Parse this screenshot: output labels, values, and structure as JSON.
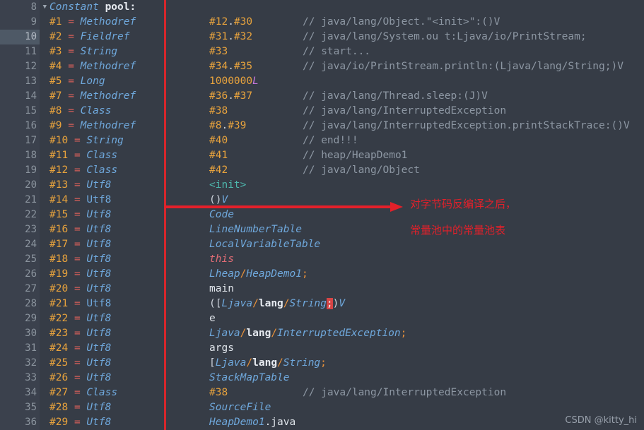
{
  "editor": {
    "theme_bg": "#363c46",
    "gutter_bg": "#3b414d",
    "accent_red": "#d6272c",
    "highlighted_line": 10
  },
  "gutter": {
    "lines": [
      "8",
      "9",
      "10",
      "11",
      "12",
      "13",
      "14",
      "15",
      "16",
      "17",
      "18",
      "19",
      "20",
      "21",
      "22",
      "23",
      "24",
      "25",
      "26",
      "27",
      "28",
      "29",
      "30",
      "31",
      "32",
      "33",
      "34",
      "35",
      "36"
    ],
    "fold_caret": "▼"
  },
  "code_lines": [
    {
      "num": "8",
      "a_index": "",
      "a_eq": "",
      "a_type": "Constant pool:",
      "a_style": "header",
      "b": "",
      "c": ""
    },
    {
      "num": "9",
      "a_index": "#1",
      "a_eq": "=",
      "a_type": "Methodref",
      "a_style": "kw",
      "b": "#12.#30",
      "b_style": "num",
      "c": "// java/lang/Object.\"<init>\":()V"
    },
    {
      "num": "10",
      "a_index": "#2",
      "a_eq": "=",
      "a_type": "Fieldref",
      "a_style": "kw",
      "b": "#31.#32",
      "b_style": "num",
      "c": "// java/lang/System.ou t:Ljava/io/PrintStream;"
    },
    {
      "num": "11",
      "a_index": "#3",
      "a_eq": "=",
      "a_type": "String",
      "a_style": "kw",
      "b": "#33",
      "b_style": "num",
      "c": "// start..."
    },
    {
      "num": "12",
      "a_index": "#4",
      "a_eq": "=",
      "a_type": "Methodref",
      "a_style": "kw",
      "b": "#34.#35",
      "b_style": "num",
      "c": "// java/io/PrintStream.println:(Ljava/lang/String;)V"
    },
    {
      "num": "13",
      "a_index": "#5",
      "a_eq": "=",
      "a_type": "Long",
      "a_style": "kw",
      "b": "1000000L",
      "b_style": "longlit",
      "c": ""
    },
    {
      "num": "14",
      "a_index": "#7",
      "a_eq": "=",
      "a_type": "Methodref",
      "a_style": "kw",
      "b": "#36.#37",
      "b_style": "num",
      "c": "// java/lang/Thread.sleep:(J)V"
    },
    {
      "num": "15",
      "a_index": "#8",
      "a_eq": "=",
      "a_type": "Class",
      "a_style": "kw",
      "b": "#38",
      "b_style": "num",
      "c": "// java/lang/InterruptedException"
    },
    {
      "num": "16",
      "a_index": "#9",
      "a_eq": "=",
      "a_type": "Methodref",
      "a_style": "kw",
      "b": "#8.#39",
      "b_style": "num",
      "c": "// java/lang/InterruptedException.printStackTrace:()V"
    },
    {
      "num": "17",
      "a_index": "#10",
      "a_eq": "=",
      "a_type": "String",
      "a_style": "kw",
      "b": "#40",
      "b_style": "num",
      "c": "// end!!!"
    },
    {
      "num": "18",
      "a_index": "#11",
      "a_eq": "=",
      "a_type": "Class",
      "a_style": "kw",
      "b": "#41",
      "b_style": "num",
      "c": "// heap/HeapDemo1"
    },
    {
      "num": "19",
      "a_index": "#12",
      "a_eq": "=",
      "a_type": "Class",
      "a_style": "kw",
      "b": "#42",
      "b_style": "num",
      "c": "// java/lang/Object"
    },
    {
      "num": "20",
      "a_index": "#13",
      "a_eq": "=",
      "a_type": "Utf8",
      "a_style": "kw",
      "b": "<init>",
      "b_style": "init",
      "c": ""
    },
    {
      "num": "21",
      "a_index": "#14",
      "a_eq": "=",
      "a_type": "Utf8",
      "a_style": "kwn",
      "b": "()V",
      "b_style": "parenV",
      "c": ""
    },
    {
      "num": "22",
      "a_index": "#15",
      "a_eq": "=",
      "a_type": "Utf8",
      "a_style": "kw",
      "b": "Code",
      "b_style": "sig",
      "c": ""
    },
    {
      "num": "23",
      "a_index": "#16",
      "a_eq": "=",
      "a_type": "Utf8",
      "a_style": "kw",
      "b": "LineNumberTable",
      "b_style": "sig",
      "c": ""
    },
    {
      "num": "24",
      "a_index": "#17",
      "a_eq": "=",
      "a_type": "Utf8",
      "a_style": "kw",
      "b": "LocalVariableTable",
      "b_style": "sig",
      "c": ""
    },
    {
      "num": "25",
      "a_index": "#18",
      "a_eq": "=",
      "a_type": "Utf8",
      "a_style": "kw",
      "b": "this",
      "b_style": "this",
      "c": ""
    },
    {
      "num": "26",
      "a_index": "#19",
      "a_eq": "=",
      "a_type": "Utf8",
      "a_style": "kw",
      "b": "Lheap/HeapDemo1;",
      "b_style": "desc1",
      "c": ""
    },
    {
      "num": "27",
      "a_index": "#20",
      "a_eq": "=",
      "a_type": "Utf8",
      "a_style": "kw",
      "b": "main",
      "b_style": "white",
      "c": ""
    },
    {
      "num": "28",
      "a_index": "#21",
      "a_eq": "=",
      "a_type": "Utf8",
      "a_style": "kwn",
      "b": "([Ljava/lang/String;)V",
      "b_style": "desc_main",
      "c": ""
    },
    {
      "num": "29",
      "a_index": "#22",
      "a_eq": "=",
      "a_type": "Utf8",
      "a_style": "kw",
      "b": "e",
      "b_style": "white",
      "c": ""
    },
    {
      "num": "30",
      "a_index": "#23",
      "a_eq": "=",
      "a_type": "Utf8",
      "a_style": "kw",
      "b": "Ljava/lang/InterruptedException;",
      "b_style": "desc_exc",
      "c": ""
    },
    {
      "num": "31",
      "a_index": "#24",
      "a_eq": "=",
      "a_type": "Utf8",
      "a_style": "kw",
      "b": "args",
      "b_style": "white",
      "c": ""
    },
    {
      "num": "32",
      "a_index": "#25",
      "a_eq": "=",
      "a_type": "Utf8",
      "a_style": "kw",
      "b": "[Ljava/lang/String;",
      "b_style": "desc_str",
      "c": ""
    },
    {
      "num": "33",
      "a_index": "#26",
      "a_eq": "=",
      "a_type": "Utf8",
      "a_style": "kw",
      "b": "StackMapTable",
      "b_style": "sig",
      "c": ""
    },
    {
      "num": "34",
      "a_index": "#27",
      "a_eq": "=",
      "a_type": "Class",
      "a_style": "kw",
      "b": "#38",
      "b_style": "num",
      "c": "// java/lang/InterruptedException"
    },
    {
      "num": "35",
      "a_index": "#28",
      "a_eq": "=",
      "a_type": "Utf8",
      "a_style": "kw",
      "b": "SourceFile",
      "b_style": "sig",
      "c": ""
    },
    {
      "num": "36",
      "a_index": "#29",
      "a_eq": "=",
      "a_type": "Utf8",
      "a_style": "kw",
      "b": "HeapDemo1.java",
      "b_style": "srcfile",
      "c": ""
    }
  ],
  "header_line": {
    "keyword": "Constant",
    "rest": " pool:"
  },
  "annotations": {
    "line_1": "对字节码反编译之后，",
    "line_2": "常量池中的常量池表",
    "arrow_color": "#e4202a"
  },
  "watermark": "CSDN @kitty_hi"
}
